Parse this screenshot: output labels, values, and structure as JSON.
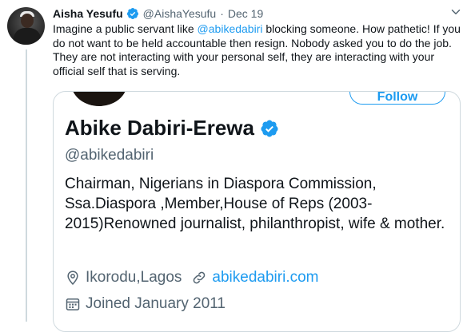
{
  "tweet": {
    "author_name": "Aisha Yesufu",
    "author_handle": "@AishaYesufu",
    "separator": "·",
    "date": "Dec 19",
    "text_before": "Imagine a public servant like ",
    "mention": "@abikedabiri",
    "text_after": " blocking someone. How pathetic! If you do not want to be held accountable then resign. Nobody asked you to do the job. They are not interacting with your personal self, they are interacting with your official self that is serving."
  },
  "profile_card": {
    "follow_label": "Follow",
    "name": "Abike Dabiri-Erewa",
    "handle": "@abikedabiri",
    "bio": "Chairman, Nigerians in Diaspora Commission, Ssa.Diaspora ,Member,House of Reps (2003-2015)Renowned journalist, philanthropist, wife & mother.",
    "location": "Ikorodu,Lagos",
    "website": "abikedabiri.com",
    "joined": "Joined January 2011"
  },
  "colors": {
    "accent": "#1d9bf0",
    "secondary_text": "#536471",
    "primary_text": "#0f1419",
    "border": "#cfd9de"
  },
  "icons": {
    "verified": "verified-badge-icon",
    "more": "chevron-down-icon",
    "location": "location-pin-icon",
    "link": "link-icon",
    "calendar": "calendar-icon"
  }
}
